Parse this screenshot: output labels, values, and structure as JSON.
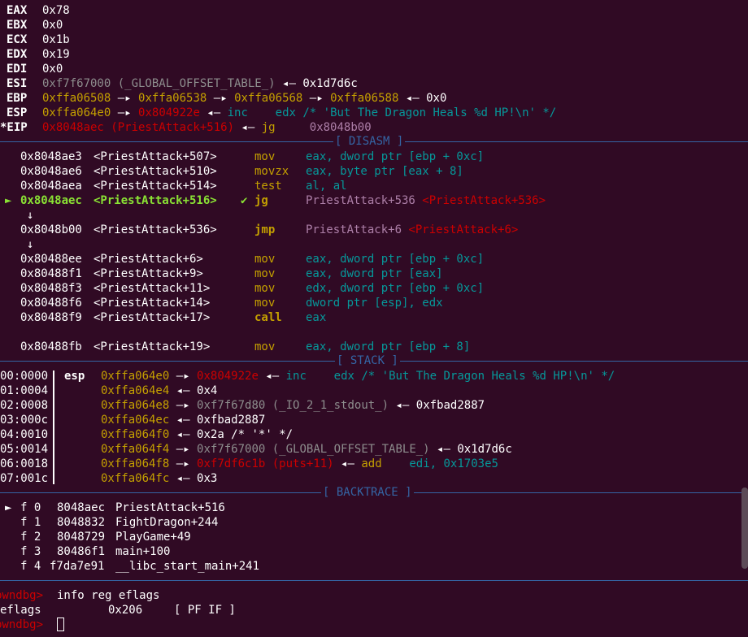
{
  "colors": {
    "background": "#300a24",
    "yellow": "#c4a000",
    "red": "#cc0000",
    "grey": "#8d8d8d",
    "magenta": "#ad7fa8",
    "cyan": "#06989a",
    "blue": "#3465a4",
    "green": "#8ae234"
  },
  "sections": {
    "disasm": "[ DISASM ]",
    "stack": "[ STACK ]",
    "backtrace": "[ BACKTRACE ]"
  },
  "registers": {
    "eax": {
      "name": "EAX",
      "value": "0x78"
    },
    "ebx": {
      "name": "EBX",
      "value": "0x0"
    },
    "ecx": {
      "name": "ECX",
      "value": "0x1b"
    },
    "edx": {
      "name": "EDX",
      "value": "0x19"
    },
    "edi": {
      "name": "EDI",
      "value": "0x0"
    },
    "esi": {
      "name": "ESI",
      "value": "0xf7f67000 (_GLOBAL_OFFSET_TABLE_)",
      "arrow": "◂—",
      "target": "0x1d7d6c"
    },
    "ebp": {
      "name": "EBP",
      "v1": "0xffa06508",
      "v2": "0xffa06538",
      "v3": "0xffa06568",
      "v4": "0xffa06588",
      "v5": "0x0"
    },
    "esp": {
      "name": "ESP",
      "v1": "0xffa064e0",
      "v2": "0x804922e",
      "op": "inc",
      "operand": "edx /* 'But The Dragon Heals %d HP!\\n' */"
    },
    "eip": {
      "name": "*EIP",
      "value": "0x8048aec (PriestAttack+516)",
      "op": "jg",
      "operand": "0x8048b00"
    }
  },
  "arrows": {
    "right": "—▸",
    "left": "◂—",
    "down": "↓",
    "current": "►",
    "check": "✔"
  },
  "disasm": [
    {
      "addr": "0x8048ae3",
      "sym": "<PriestAttack+507>",
      "mnem": "mov",
      "ops": "eax, dword ptr [ebp + 0xc]"
    },
    {
      "addr": "0x8048ae6",
      "sym": "<PriestAttack+510>",
      "mnem": "movzx",
      "ops": "eax, byte ptr [eax + 8]"
    },
    {
      "addr": "0x8048aea",
      "sym": "<PriestAttack+514>",
      "mnem": "test",
      "ops": "al, al"
    },
    {
      "addr": "0x8048aec",
      "sym": "<PriestAttack+516>",
      "mnem": "jg",
      "ops": "PriestAttack+536",
      "ref": "<PriestAttack+536>"
    },
    {
      "addr": "0x8048b00",
      "sym": "<PriestAttack+536>",
      "mnem": "jmp",
      "ops": "PriestAttack+6",
      "ref": "<PriestAttack+6>"
    },
    {
      "addr": "0x80488ee",
      "sym": "<PriestAttack+6>",
      "mnem": "mov",
      "ops": "eax, dword ptr [ebp + 0xc]"
    },
    {
      "addr": "0x80488f1",
      "sym": "<PriestAttack+9>",
      "mnem": "mov",
      "ops": "eax, dword ptr [eax]"
    },
    {
      "addr": "0x80488f3",
      "sym": "<PriestAttack+11>",
      "mnem": "mov",
      "ops": "edx, dword ptr [ebp + 0xc]"
    },
    {
      "addr": "0x80488f6",
      "sym": "<PriestAttack+14>",
      "mnem": "mov",
      "ops": "dword ptr [esp], edx"
    },
    {
      "addr": "0x80488f9",
      "sym": "<PriestAttack+17>",
      "mnem": "call",
      "ops": "eax"
    },
    {
      "addr": "0x80488fb",
      "sym": "<PriestAttack+19>",
      "mnem": "mov",
      "ops": "eax, dword ptr [ebp + 8]"
    }
  ],
  "stack": [
    {
      "off": "00:0000",
      "reg": "esp",
      "addr": "0xffa064e0",
      "val": "0x804922e",
      "op": "inc",
      "operand": "edx /* 'But The Dragon Heals %d HP!\\n' */"
    },
    {
      "off": "01:0004",
      "addr": "0xffa064e4",
      "val": "0x4"
    },
    {
      "off": "02:0008",
      "addr": "0xffa064e8",
      "val": "0xf7f67d80 (_IO_2_1_stdout_)",
      "target": "0xfbad2887"
    },
    {
      "off": "03:000c",
      "addr": "0xffa064ec",
      "val": "0xfbad2887"
    },
    {
      "off": "04:0010",
      "addr": "0xffa064f0",
      "val": "0x2a /* '*' */"
    },
    {
      "off": "05:0014",
      "addr": "0xffa064f4",
      "val": "0xf7f67000 (_GLOBAL_OFFSET_TABLE_)",
      "target": "0x1d7d6c"
    },
    {
      "off": "06:0018",
      "addr": "0xffa064f8",
      "val": "0xf7df6c1b (puts+11)",
      "op": "add",
      "operand": "edi, 0x1703e5"
    },
    {
      "off": "07:001c",
      "addr": "0xffa064fc",
      "val": "0x3"
    }
  ],
  "backtrace": [
    {
      "frame": "f 0",
      "addr": "8048aec",
      "sym": "PriestAttack+516"
    },
    {
      "frame": "f 1",
      "addr": "8048832",
      "sym": "FightDragon+244"
    },
    {
      "frame": "f 2",
      "addr": "8048729",
      "sym": "PlayGame+49"
    },
    {
      "frame": "f 3",
      "addr": "80486f1",
      "sym": "main+100"
    },
    {
      "frame": "f 4",
      "addr": "f7da7e91",
      "sym": "__libc_start_main+241"
    }
  ],
  "console": {
    "prompt": "pwndbg>",
    "command": "info reg eflags",
    "out_name": "eflags",
    "out_value": "0x206",
    "out_flags": "[ PF IF ]",
    "prompt2": "pwndbg>"
  }
}
